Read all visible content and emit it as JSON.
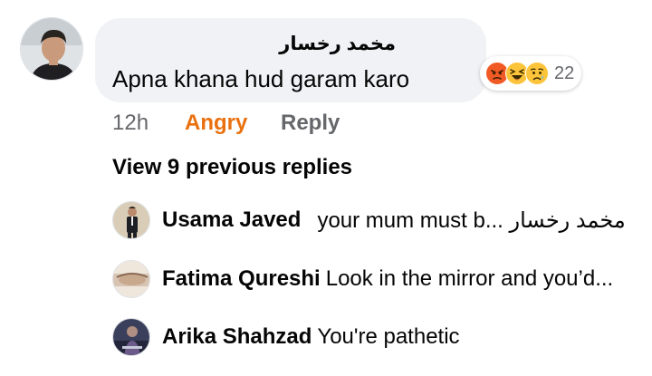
{
  "comment": {
    "author": "مخمد رخسار",
    "text": "Apna khana hud garam karo",
    "reaction_icons": [
      "angry-reaction-icon",
      "haha-reaction-icon",
      "sad-reaction-icon"
    ],
    "reaction_count": "22",
    "time": "12h",
    "my_reaction": "Angry",
    "reply_label": "Reply"
  },
  "view_previous": "View 9 previous replies",
  "replies": [
    {
      "name": "Usama Javed",
      "text": "your mum must b... مخمد رخسار"
    },
    {
      "name": "Fatima Qureshi",
      "text": "Look in the mirror and you’d..."
    },
    {
      "name": "Arika Shahzad",
      "text": "You're pathetic"
    }
  ],
  "colors": {
    "bubble_bg": "#f0f2f5",
    "angry": "#e9710f",
    "meta_gray": "#65676b",
    "text": "#050505"
  }
}
